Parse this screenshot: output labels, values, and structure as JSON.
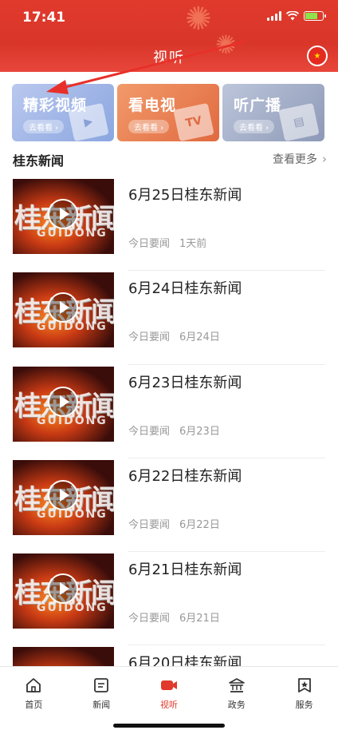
{
  "status": {
    "time": "17:41"
  },
  "header": {
    "title": "视听"
  },
  "cards": [
    {
      "title": "精彩视频",
      "pill": "去看看",
      "deco": "▶"
    },
    {
      "title": "看电视",
      "pill": "去看看",
      "deco": "TV"
    },
    {
      "title": "听广播",
      "pill": "去看看",
      "deco": "▤"
    }
  ],
  "section": {
    "title": "桂东新闻",
    "more": "查看更多"
  },
  "thumb": {
    "big": "桂东新闻",
    "small": "GUIDONG"
  },
  "news": [
    {
      "title": "6月25日桂东新闻",
      "tag": "今日要闻",
      "time": "1天前"
    },
    {
      "title": "6月24日桂东新闻",
      "tag": "今日要闻",
      "time": "6月24日"
    },
    {
      "title": "6月23日桂东新闻",
      "tag": "今日要闻",
      "time": "6月23日"
    },
    {
      "title": "6月22日桂东新闻",
      "tag": "今日要闻",
      "time": "6月22日"
    },
    {
      "title": "6月21日桂东新闻",
      "tag": "今日要闻",
      "time": "6月21日"
    },
    {
      "title": "6月20日桂东新闻",
      "tag": "",
      "time": ""
    }
  ],
  "nav": [
    {
      "label": "首页",
      "icon": "home-icon"
    },
    {
      "label": "新闻",
      "icon": "news-icon"
    },
    {
      "label": "视听",
      "icon": "video-icon"
    },
    {
      "label": "政务",
      "icon": "government-icon"
    },
    {
      "label": "服务",
      "icon": "service-icon"
    }
  ],
  "colors": {
    "brand_red": "#e03a2c",
    "nav_active": "#e03a2c"
  }
}
